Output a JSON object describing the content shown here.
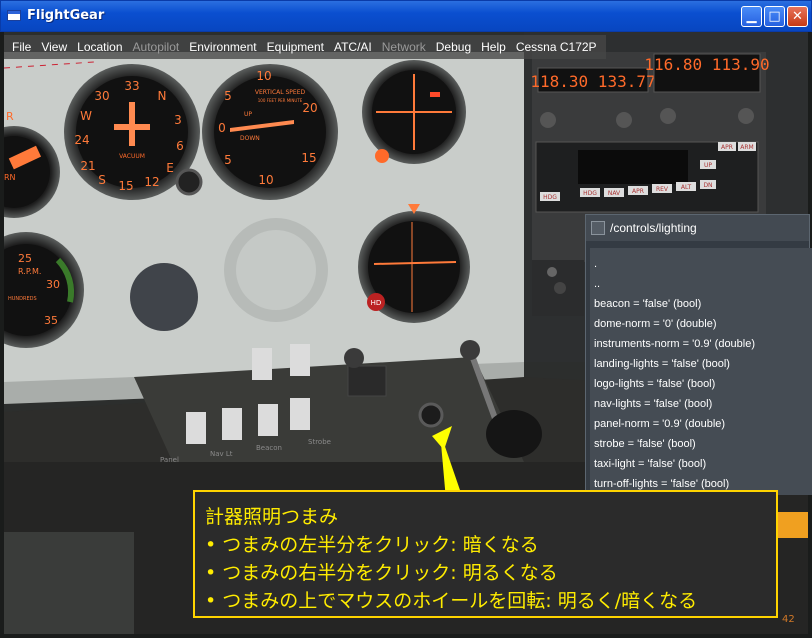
{
  "window": {
    "title": "FlightGear",
    "min_glyph": "▁",
    "max_glyph": "□",
    "close_glyph": "✕"
  },
  "menu": {
    "items": [
      {
        "label": "File",
        "enabled": true
      },
      {
        "label": "View",
        "enabled": true
      },
      {
        "label": "Location",
        "enabled": true
      },
      {
        "label": "Autopilot",
        "enabled": false
      },
      {
        "label": "Environment",
        "enabled": true
      },
      {
        "label": "Equipment",
        "enabled": true
      },
      {
        "label": "ATC/AI",
        "enabled": true
      },
      {
        "label": "Network",
        "enabled": false
      },
      {
        "label": "Debug",
        "enabled": true
      },
      {
        "label": "Help",
        "enabled": true
      },
      {
        "label": "Cessna C172P",
        "enabled": true
      }
    ]
  },
  "instruments": {
    "com_freq": "118.30 133.77",
    "nav_freq": "116.80 113.90",
    "vsi_label_top": "VERTICAL SPEED",
    "vsi_label_sub": "100 FEET PER MINUTE",
    "vsi_up": "UP",
    "vsi_down": "DOWN",
    "vsi_10": "10",
    "vsi_20": "20",
    "vsi_5": "5",
    "vsi_15": "15",
    "vsi_0": "0",
    "hi_labels": [
      "33",
      "N",
      "3",
      "6",
      "E",
      "12",
      "15",
      "S",
      "21",
      "24",
      "W",
      "30"
    ],
    "vacuum": "VACUUM",
    "ap_buttons": [
      "HDG",
      "NAV",
      "APR",
      "REV",
      "ALT",
      "DN"
    ],
    "ap_right": [
      "UP",
      "APR",
      "ARM"
    ],
    "hd_badge": "HD",
    "rpm_label": "R.P.M.",
    "tach_25": "25",
    "tach_30": "30",
    "tach_35": "35",
    "tach_hundreds": "HUNDREDS",
    "switch_labels": [
      "Panel",
      "Nav Lt",
      "Beacon",
      "Strobe"
    ],
    "left_r": "R",
    "left_rn": "RN"
  },
  "dialog": {
    "title": "/controls/lighting",
    "entries": [
      ".",
      "..",
      "beacon = 'false' (bool)",
      "dome-norm = '0' (double)",
      "instruments-norm = '0.9' (double)",
      "landing-lights = 'false' (bool)",
      "logo-lights = 'false' (bool)",
      "nav-lights = 'false' (bool)",
      "panel-norm = '0.9' (double)",
      "strobe = 'false' (bool)",
      "taxi-light = 'false' (bool)",
      "turn-off-lights = 'false' (bool)"
    ]
  },
  "callout": {
    "heading": "計器照明つまみ",
    "lines": [
      "•  つまみの左半分をクリック: 暗くなる",
      "•  つまみの右半分をクリック: 明るくなる",
      "•  つまみの上でマウスのホイールを回転: 明るく/暗くなる"
    ]
  },
  "fps": "42",
  "colors": {
    "accent_yellow": "#ffec00",
    "instrument_orange": "#ff6a2a",
    "titlebar_blue": "#0a4fd0"
  }
}
